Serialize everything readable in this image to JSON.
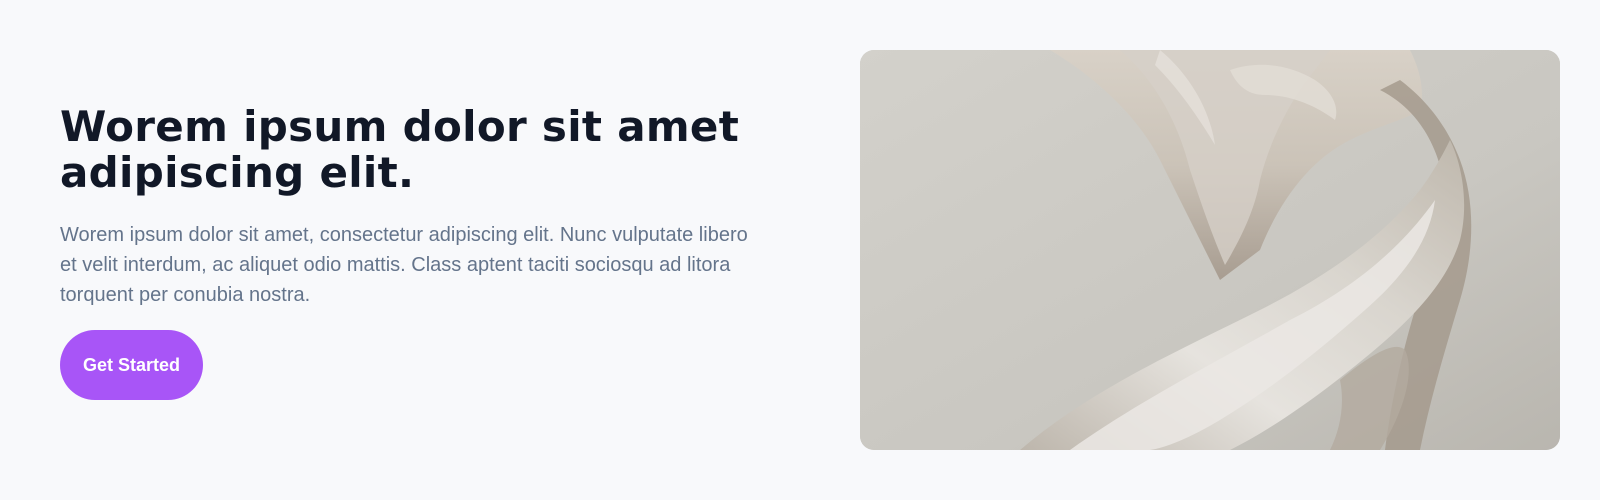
{
  "hero": {
    "title": "Worem ipsum dolor sit amet adipiscing elit.",
    "description": "Worem ipsum dolor sit amet, consectetur adipiscing elit. Nunc vulputate libero et velit interdum, ac aliquet odio mattis. Class aptent taciti sociosqu ad litora torquent per conubia nostra.",
    "cta_label": "Get Started",
    "image_subject": "flowing-white-fabric-sculpture"
  },
  "colors": {
    "background": "#f8f9fb",
    "title": "#111827",
    "description": "#64748b",
    "cta_background": "#a855f7",
    "cta_text": "#ffffff",
    "image_backdrop": "#cdcbc5"
  }
}
